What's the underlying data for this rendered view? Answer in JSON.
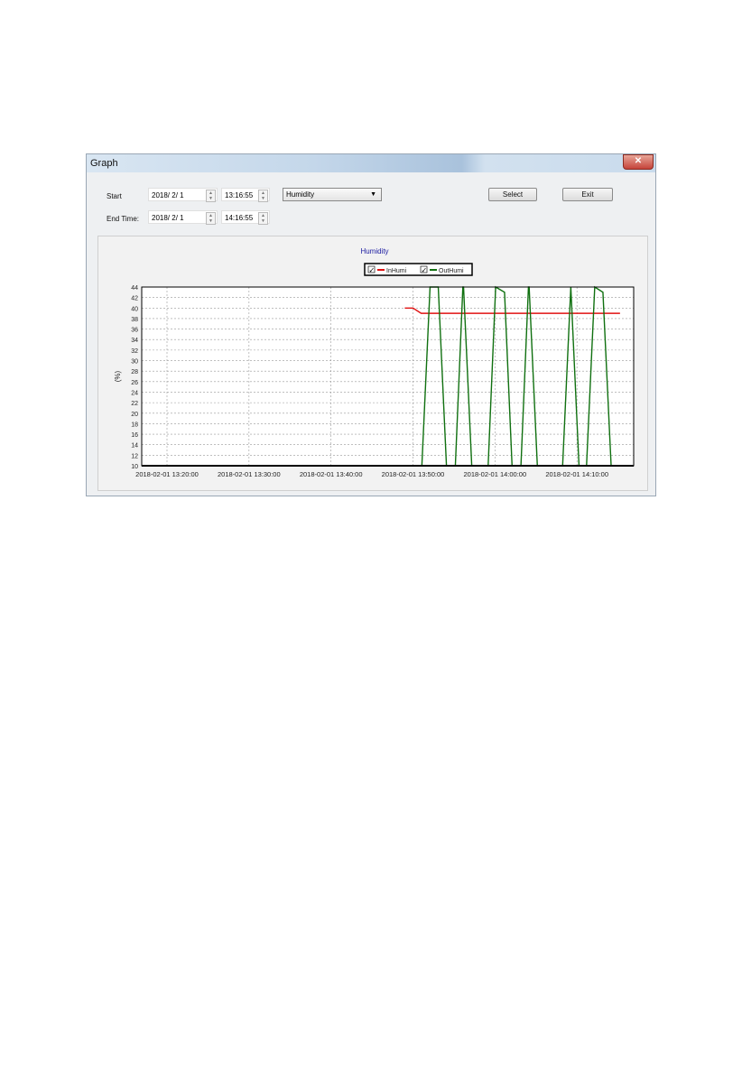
{
  "window": {
    "title": "Graph",
    "close_icon": "close-icon"
  },
  "controls": {
    "start_label": "Start",
    "start_date": "2018/ 2/ 1",
    "start_time": "13:16:55",
    "end_label": "End Time:",
    "end_date": "2018/ 2/ 1",
    "end_time": "14:16:55",
    "type_select": "Humidity",
    "select_button": "Select",
    "exit_button": "Exit"
  },
  "chart_data": {
    "type": "line",
    "title": "Humidity",
    "ylabel": "(%)",
    "xlabel": "",
    "xlim": [
      "13:16:55",
      "14:16:55"
    ],
    "ylim": [
      10,
      44
    ],
    "yticks": [
      10,
      12,
      14,
      16,
      18,
      20,
      22,
      24,
      26,
      28,
      30,
      32,
      34,
      36,
      38,
      40,
      42,
      44
    ],
    "xticks": [
      "2018-02-01 13:20:00",
      "2018-02-01 13:30:00",
      "2018-02-01 13:40:00",
      "2018-02-01 13:50:00",
      "2018-02-01 14:00:00",
      "2018-02-01 14:10:00"
    ],
    "grid": true,
    "legend_placement": "top-center",
    "series": [
      {
        "name": "InHumi",
        "color": "#e01010",
        "checked": true,
        "x": [
          "13:49:00",
          "13:50:00",
          "13:51:00",
          "14:15:15"
        ],
        "y": [
          40,
          40,
          39,
          39
        ]
      },
      {
        "name": "OutHumi",
        "color": "#107010",
        "checked": true,
        "x": [
          "13:49:00",
          "13:51:05",
          "13:52:05",
          "13:53:05",
          "13:54:05",
          "13:55:10",
          "13:56:05",
          "13:56:10",
          "13:57:10",
          "13:59:10",
          "14:00:05",
          "14:01:10",
          "14:02:05",
          "14:03:10",
          "14:04:05",
          "14:04:10",
          "14:05:10",
          "14:08:15",
          "14:09:15",
          "14:10:15",
          "14:11:10",
          "14:12:10",
          "14:13:10",
          "14:14:10"
        ],
        "y": [
          10,
          10,
          44,
          44,
          10,
          10,
          44,
          44,
          10,
          10,
          44,
          43,
          10,
          10,
          44,
          44,
          10,
          10,
          44,
          10,
          10,
          44,
          43,
          10
        ]
      }
    ]
  }
}
